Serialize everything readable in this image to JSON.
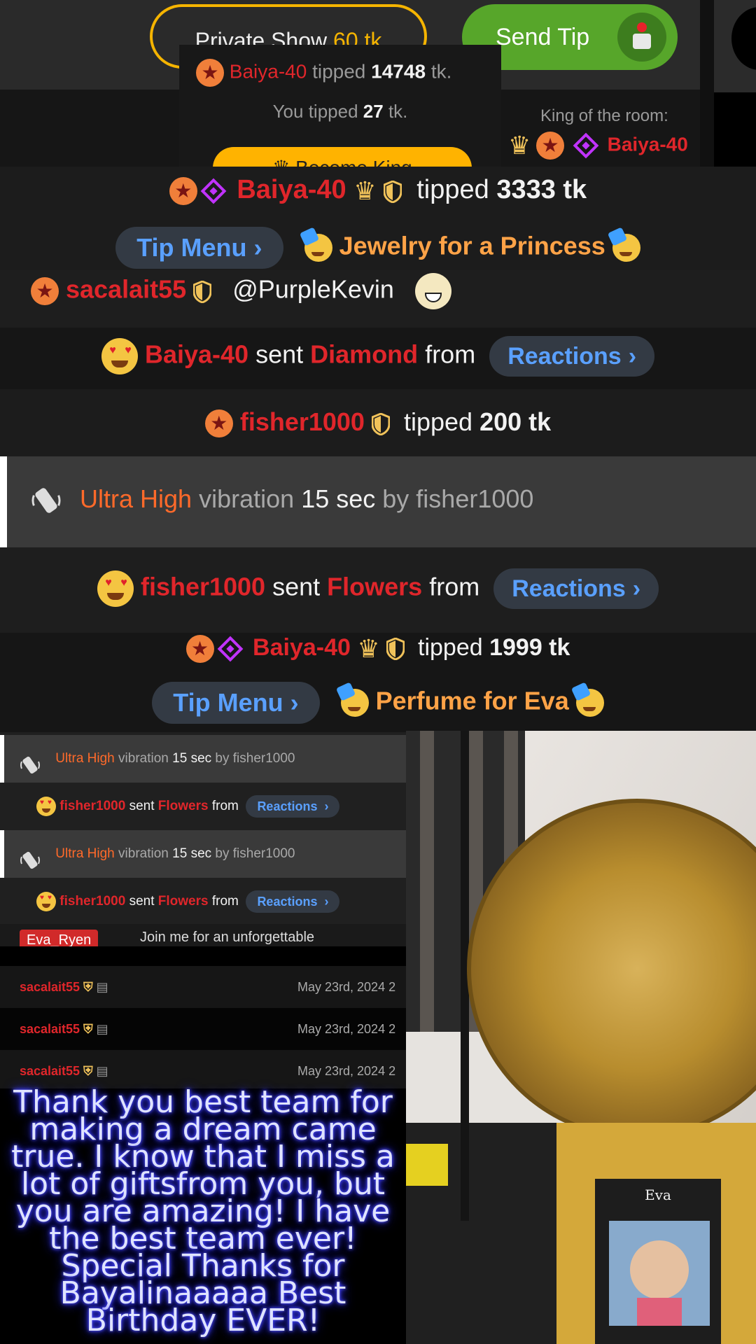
{
  "top_bar": {
    "private_show_label": "Private Show",
    "private_show_price": "60 tk",
    "send_tip_label": "Send Tip"
  },
  "king_popup": {
    "line1_user": "Baiya-40",
    "line1_action": "tipped",
    "line1_amount": "14748",
    "line1_unit": "tk.",
    "line2_prefix": "You tipped",
    "line2_amount": "27",
    "line2_unit": "tk.",
    "become_king_label": "Become King",
    "king_label": "King of the room:",
    "king_name": "Baiya-40"
  },
  "chat": {
    "r1": {
      "user": "Baiya-40",
      "action": "tipped",
      "amount": "3333 tk",
      "menu_label": "Tip Menu",
      "item": "Jewelry for a Princess"
    },
    "r2": {
      "user": "sacalait55",
      "mention": "@PurpleKevin"
    },
    "r3": {
      "user": "Baiya-40",
      "sent": "sent",
      "gift": "Diamond",
      "from": "from",
      "reactions_label": "Reactions"
    },
    "r4": {
      "user": "fisher1000",
      "action": "tipped",
      "amount": "200 tk"
    },
    "r5": {
      "level": "Ultra High",
      "vib": "vibration",
      "duration": "15 sec",
      "by": "by fisher1000"
    },
    "r6": {
      "user": "fisher1000",
      "sent": "sent",
      "gift": "Flowers",
      "from": "from",
      "reactions_label": "Reactions"
    },
    "r7": {
      "user": "Baiya-40",
      "action": "tipped",
      "amount": "1999 tk",
      "menu_label": "Tip Menu",
      "item": "Perfume for Eva"
    }
  },
  "small_chat": [
    {
      "level": "Ultra High",
      "vib": "vibration",
      "duration": "15 sec",
      "by": "by fisher1000"
    },
    {
      "user": "fisher1000",
      "sent": "sent",
      "gift": "Flowers",
      "from": "from",
      "reactions_label": "Reactions"
    },
    {
      "level": "Ultra High",
      "vib": "vibration",
      "duration": "15 sec",
      "by": "by fisher1000"
    },
    {
      "user": "fisher1000",
      "sent": "sent",
      "gift": "Flowers",
      "from": "from",
      "reactions_label": "Reactions"
    }
  ],
  "promo": {
    "tag": "Eva_Ryen",
    "text": "Join me for an unforgettable"
  },
  "log": [
    {
      "user": "sacalait55",
      "date": "May 23rd, 2024 2"
    },
    {
      "user": "sacalait55",
      "date": "May 23rd, 2024 2"
    },
    {
      "user": "sacalait55",
      "date": "May 23rd, 2024 2"
    }
  ],
  "thanks_message": "Thank you best team for making a dream came true. I know that I miss a lot of giftsfrom you, but you are amazing! I have the best team ever! Special Thanks for Bayalinaaaaa Best Birthday EVER!",
  "photo": {
    "frame_caption": "Eva"
  }
}
